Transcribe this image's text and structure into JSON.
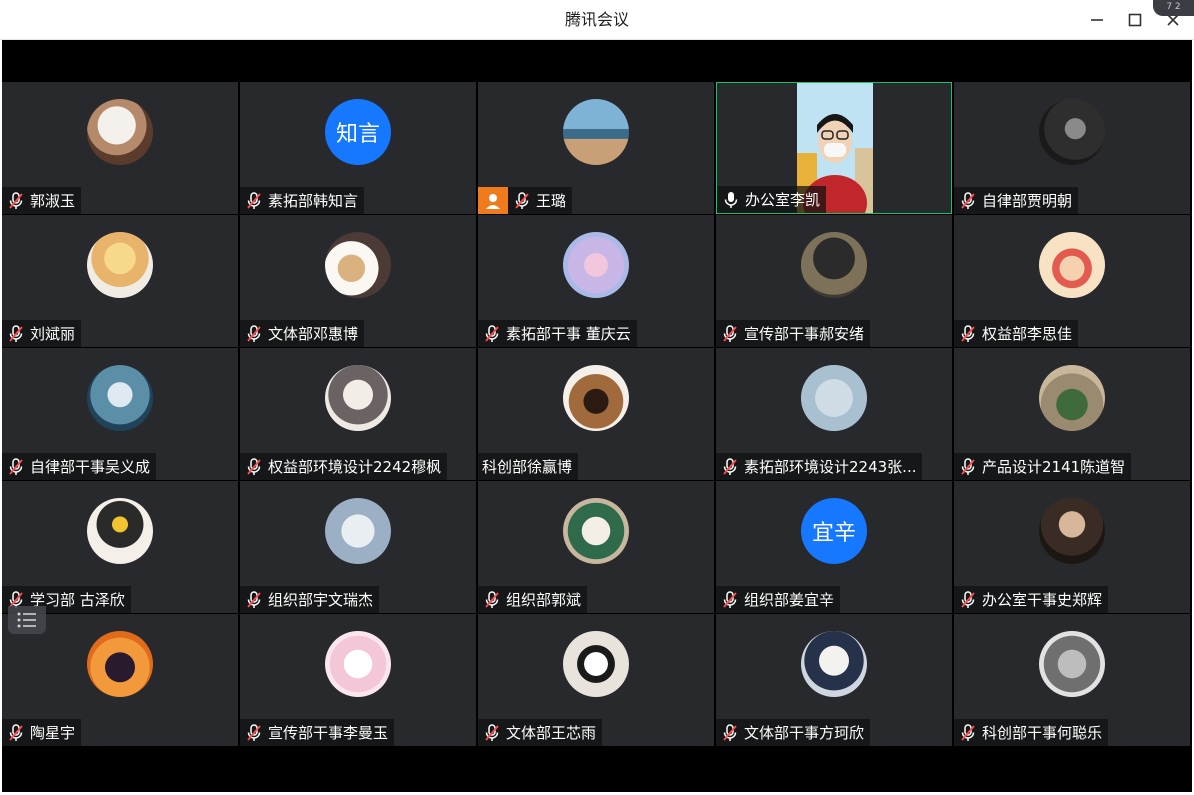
{
  "window": {
    "title": "腾讯会议",
    "controls": [
      "minimize-icon",
      "maximize-icon",
      "close-icon"
    ],
    "corner_badge": "7 2"
  },
  "colors": {
    "tile_bg": "#27292d",
    "stage_bg": "#000000",
    "active_border": "#1fbf6a",
    "text_avatar_blue": "#1677ff",
    "host_badge": "#f07b1c"
  },
  "participants": [
    {
      "name": "郭淑玉",
      "mic": "muted"
    },
    {
      "name": "素拓部韩知言",
      "mic": "muted",
      "avatar_text": "知言"
    },
    {
      "name": "王璐",
      "mic": "muted",
      "host": true
    },
    {
      "name": "办公室李凯",
      "mic": "on",
      "video": true,
      "active": true
    },
    {
      "name": "自律部贾明朝",
      "mic": "muted"
    },
    {
      "name": "刘斌丽",
      "mic": "muted"
    },
    {
      "name": "文体部邓惠博",
      "mic": "muted"
    },
    {
      "name": "素拓部干事 董庆云",
      "mic": "muted"
    },
    {
      "name": "宣传部干事郝安绪",
      "mic": "muted"
    },
    {
      "name": "权益部李思佳",
      "mic": "muted"
    },
    {
      "name": "自律部干事吴义成",
      "mic": "muted"
    },
    {
      "name": "权益部环境设计2242穆枫",
      "mic": "muted"
    },
    {
      "name": "科创部徐赢博",
      "mic": "none"
    },
    {
      "name": "素拓部环境设计2243张...",
      "mic": "muted"
    },
    {
      "name": "产品设计2141陈道智",
      "mic": "muted"
    },
    {
      "name": "学习部 古泽欣",
      "mic": "muted"
    },
    {
      "name": "组织部宇文瑞杰",
      "mic": "muted"
    },
    {
      "name": "组织部郭斌",
      "mic": "muted"
    },
    {
      "name": "组织部姜宜辛",
      "mic": "muted",
      "avatar_text": "宜辛"
    },
    {
      "name": "办公室干事史郑辉",
      "mic": "muted"
    },
    {
      "name": "陶星宇",
      "mic": "muted"
    },
    {
      "name": "宣传部干事李曼玉",
      "mic": "muted"
    },
    {
      "name": "文体部王芯雨",
      "mic": "muted"
    },
    {
      "name": "文体部干事方珂欣",
      "mic": "muted"
    },
    {
      "name": "科创部干事何聪乐",
      "mic": "muted"
    }
  ],
  "participant_list_toggle": "list-icon"
}
